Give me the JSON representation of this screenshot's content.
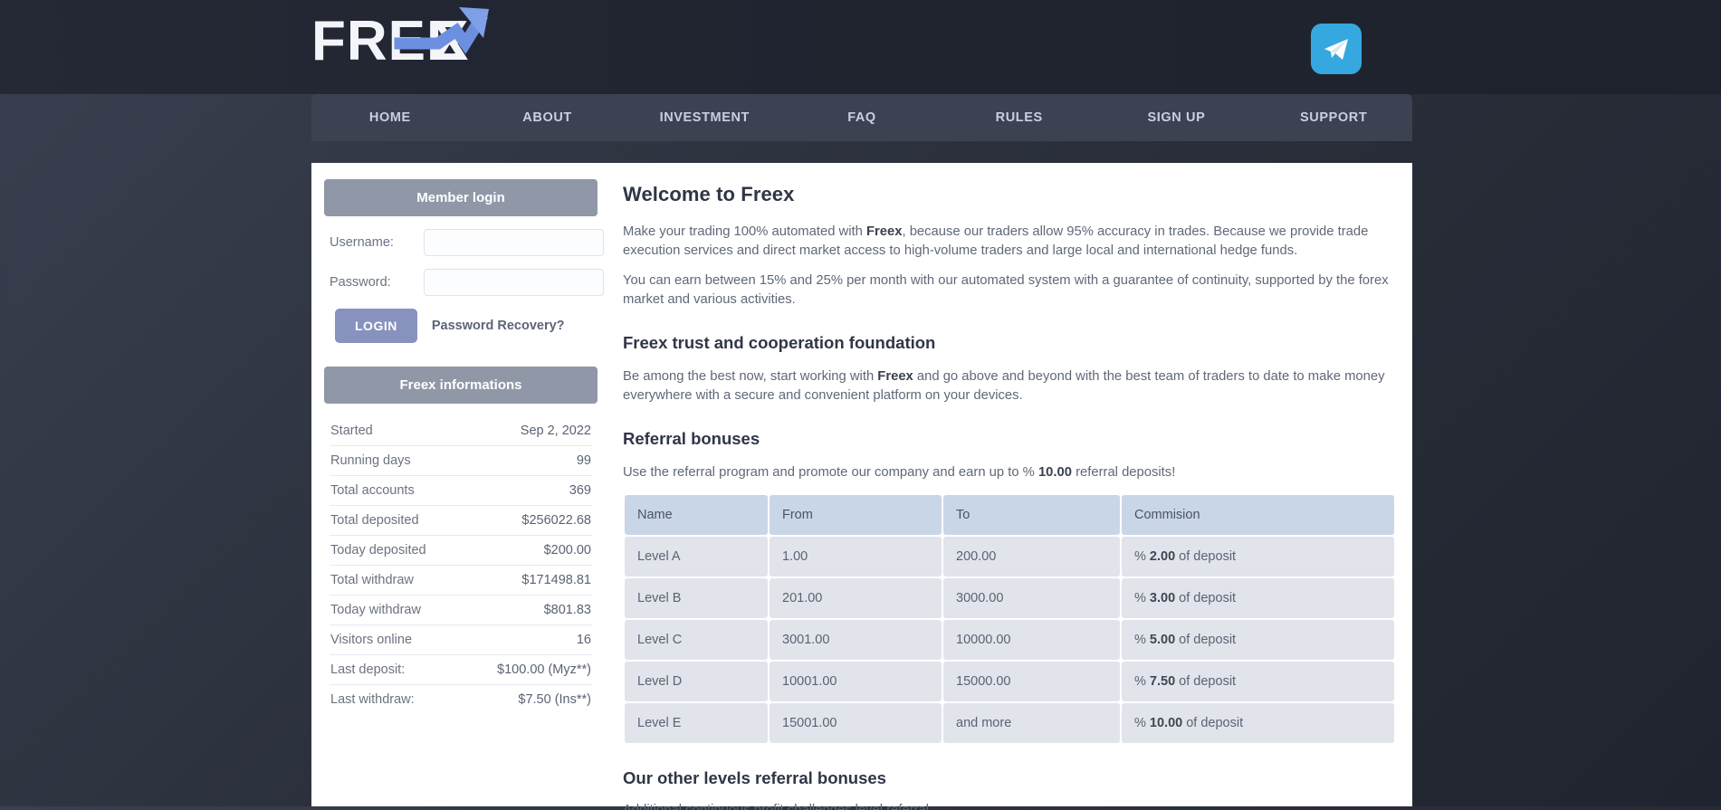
{
  "brand": {
    "logo_text": "FREEX",
    "logo_colors": {
      "text": "#f4f5fa",
      "accent": "#6d8fe0"
    },
    "telegram_label": "telegram"
  },
  "nav": {
    "items": [
      {
        "label": "HOME",
        "name": "nav-item-home"
      },
      {
        "label": "ABOUT",
        "name": "nav-item-about"
      },
      {
        "label": "INVESTMENT",
        "name": "nav-item-investment"
      },
      {
        "label": "FAQ",
        "name": "nav-item-faq"
      },
      {
        "label": "RULES",
        "name": "nav-item-rules"
      },
      {
        "label": "SIGN UP",
        "name": "nav-item-signup"
      },
      {
        "label": "SUPPORT",
        "name": "nav-item-support"
      }
    ]
  },
  "sidebar": {
    "login": {
      "title": "Member login",
      "username_label": "Username:",
      "username_value": "",
      "password_label": "Password:",
      "password_value": "",
      "login_button": "LOGIN",
      "recovery_link": "Password Recovery?"
    },
    "info": {
      "title": "Freex informations",
      "rows": [
        {
          "label": "Started",
          "value": "Sep 2, 2022"
        },
        {
          "label": "Running days",
          "value": "99"
        },
        {
          "label": "Total accounts",
          "value": "369"
        },
        {
          "label": "Total deposited",
          "value": "$256022.68"
        },
        {
          "label": "Today deposited",
          "value": "$200.00"
        },
        {
          "label": "Total withdraw",
          "value": "$171498.81"
        },
        {
          "label": "Today withdraw",
          "value": "$801.83"
        },
        {
          "label": "Visitors online",
          "value": "16"
        },
        {
          "label": "Last deposit:",
          "value": "$100.00 (Myz**)"
        },
        {
          "label": "Last withdraw:",
          "value": "$7.50 (Ins**)"
        }
      ]
    }
  },
  "main": {
    "welcome_title": "Welcome to Freex",
    "welcome_p1_a": "Make your trading 100% automated with ",
    "welcome_p1_b": "Freex",
    "welcome_p1_c": ", because our traders allow 95% accuracy in trades. Because we provide trade execution services and direct market access to high-volume traders and large local and international hedge funds.",
    "welcome_p2": "You can earn between 15% and 25% per month with our automated system with a guarantee of continuity, supported by the forex market and various activities.",
    "trust_title": "Freex trust and cooperation foundation",
    "trust_p1_a": "Be among the best now, start working with ",
    "trust_p1_b": "Freex",
    "trust_p1_c": " and go above and beyond with the best team of traders to date to make money everywhere with a secure and convenient platform on your devices.",
    "referral_title": "Referral bonuses",
    "referral_intro_a": "Use the referral program and promote our company and earn up to % ",
    "referral_intro_b": "10.00",
    "referral_intro_c": " referral deposits!",
    "other_levels_title": "Our other levels referral bonuses",
    "other_levels_text": "Additional continuous profit challenges level referral"
  },
  "referral_table": {
    "headers": [
      "Name",
      "From",
      "To",
      "Commision"
    ],
    "rows": [
      {
        "name": "Level A",
        "from": "1.00",
        "to": "200.00",
        "pct": "2.00",
        "prefix": "% ",
        "suffix": " of deposit"
      },
      {
        "name": "Level B",
        "from": "201.00",
        "to": "3000.00",
        "pct": "3.00",
        "prefix": "% ",
        "suffix": " of deposit"
      },
      {
        "name": "Level C",
        "from": "3001.00",
        "to": "10000.00",
        "pct": "5.00",
        "prefix": "% ",
        "suffix": " of deposit"
      },
      {
        "name": "Level D",
        "from": "10001.00",
        "to": "15000.00",
        "pct": "7.50",
        "prefix": "% ",
        "suffix": " of deposit"
      },
      {
        "name": "Level E",
        "from": "15001.00",
        "to": "and more",
        "pct": "10.00",
        "prefix": "% ",
        "suffix": " of deposit"
      }
    ]
  },
  "theme": {
    "header_bg": "#232733",
    "nav_bg": "#3d4252",
    "panel_head_bg": "#9098a8",
    "button_bg": "#8792bf",
    "table_head_bg": "#c9d6e8",
    "table_cell_bg": "#e1e4ea",
    "telegram_bg": "#35a8e0"
  }
}
